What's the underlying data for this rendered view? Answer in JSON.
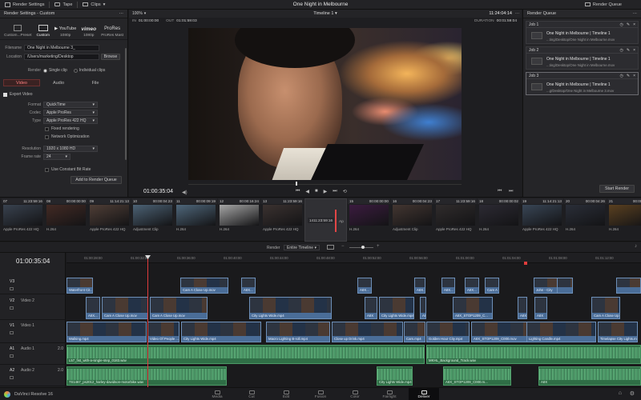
{
  "topbar": {
    "render_settings": "Render Settings",
    "tape": "Tape",
    "clips": "Clips",
    "project_title": "One Night in Melbourne",
    "render_queue": "Render Queue"
  },
  "render_settings": {
    "header": "Render Settings - Custom",
    "presets": [
      "Custom...Preset",
      "Custom",
      "1080p",
      "1080p",
      "ProRes Mast"
    ],
    "filename_label": "Filename",
    "filename_value": "One Night in Melbourne 3_",
    "location_label": "Location",
    "location_value": "/Users/marketing/Desktop",
    "browse": "Browse",
    "render_label": "Render",
    "single_clip": "Single clip",
    "individual_clips": "Individual clips",
    "tab_video": "Video",
    "tab_audio": "Audio",
    "tab_file": "File",
    "export_video": "Export Video",
    "format_label": "Format",
    "format_value": "QuickTime",
    "codec_label": "Codec",
    "codec_value": "Apple ProRes",
    "type_label": "Type",
    "type_value": "Apple ProRes 422 HQ",
    "fixed_rendering": "Fixed rendering",
    "network_opt": "Network Optimization",
    "resolution_label": "Resolution",
    "resolution_value": "1920 x 1080 HD",
    "framerate_label": "Frame rate",
    "framerate_value": "24",
    "constant_bitrate": "Use Constant Bit Rate",
    "add_to_queue": "Add to Render Queue"
  },
  "viewer": {
    "zoom": "100%",
    "in_label": "IN",
    "in_tc": "01:00:00:00",
    "out_label": "OUT",
    "out_tc": "01:01:59:03",
    "timeline_name": "Timeline 1",
    "tc_right": "11:24:04:14",
    "duration_label": "DURATION",
    "duration_tc": "00:01:59:04",
    "current_tc": "01:00:35:04"
  },
  "queue": {
    "header": "Render Queue",
    "jobs": [
      {
        "label": "Job 1",
        "title": "One Night in Melbourne | Timeline 1",
        "path": "...ting/Desktop/One Night in Melbourne.mov"
      },
      {
        "label": "Job 2",
        "title": "One Night in Melbourne | Timeline 1",
        "path": "...ting/Desktop/One Night in Melbourne.mov"
      },
      {
        "label": "Job 3",
        "title": "One Night in Melbourne | Timeline 1",
        "path": "...g/Desktop/One Night in Melbourne 3.mov"
      }
    ],
    "start_render": "Start Render"
  },
  "clipstrip": [
    {
      "num": "07",
      "tc": "11:23:59:16",
      "codec": "Apple ProRes 422 HQ",
      "thumb": "#39424f"
    },
    {
      "num": "08",
      "tc": "00:00:00:00",
      "codec": "H.264",
      "thumb": "#432a24"
    },
    {
      "num": "09",
      "tc": "11:14:21:13",
      "codec": "Apple ProRes 422 HQ",
      "thumb": "#4f3e36"
    },
    {
      "num": "10",
      "tc": "00:00:04:23",
      "codec": "Adjustment Clip",
      "thumb": "#4c6275"
    },
    {
      "num": "11",
      "tc": "00:00:09:19",
      "codec": "H.264",
      "thumb": "#4f677b"
    },
    {
      "num": "12",
      "tc": "00:00:16:24",
      "codec": "H.264",
      "thumb": "#a6a6a6"
    },
    {
      "num": "13",
      "tc": "11:23:59:16",
      "codec": "Apple ProRes 422 HQ",
      "thumb": "#3b3230"
    },
    {
      "num": "14",
      "tc": "11:23:59:16",
      "codec": "Apple ProRes 422 HQ",
      "thumb": "#5a4338"
    },
    {
      "num": "15",
      "tc": "00:00:00:00",
      "codec": "H.264",
      "thumb": "#3b1b3f"
    },
    {
      "num": "16",
      "tc": "00:00:04:23",
      "codec": "Adjustment Clip",
      "thumb": "#433631"
    },
    {
      "num": "17",
      "tc": "11:23:59:16",
      "codec": "Apple ProRes 422 HQ",
      "thumb": "#302c2c"
    },
    {
      "num": "18",
      "tc": "00:00:00:02",
      "codec": "H.264",
      "thumb": "#2c2a33"
    },
    {
      "num": "19",
      "tc": "11:14:21:13",
      "codec": "Apple ProRes 422 HQ",
      "thumb": "#394656"
    },
    {
      "num": "20",
      "tc": "00:00:04:26",
      "codec": "H.264",
      "thumb": "#2a2e38"
    },
    {
      "num": "21",
      "tc": "00:00:09:",
      "codec": "H.264",
      "thumb": "#5a4020"
    }
  ],
  "timeline": {
    "tc": "01:00:35:04",
    "render_label": "Render",
    "render_value": "Entire Timeline",
    "ruler": [
      "01:00:28:00",
      "01:00:32:00",
      "01:00:36:00",
      "01:00:40:00",
      "01:00:44:00",
      "01:00:48:00",
      "01:00:52:00",
      "01:00:56:00",
      "01:01:00:00",
      "01:01:04:00",
      "01:01:08:00",
      "01:01:12:00"
    ],
    "tracks": {
      "v3": "",
      "v2": "Video 2",
      "v1": "Video 1",
      "a1": "Audio 1",
      "a2": "Audio 2",
      "a3": "Audio 3",
      "a1_level": "2.0",
      "a2_level": "2.0",
      "a3_level": "2.0",
      "clips_label": "0 Clips"
    },
    "v3_clips": [
      "Waterfront Cit...",
      "Cam A Close Up.mov",
      "AIIX...",
      "AIIX...",
      "AIIX...",
      "AIIX...",
      "AIIX...",
      "Cam A Close Up",
      "John - City"
    ],
    "v2_clips": [
      "AIIX...",
      "Cam A Close Up.mov",
      "Cam A Close Up.mov",
      "City Lights Wide.mp4",
      "AIIX",
      "City Lights Wide.mp4",
      "AIIX...",
      "AIIX_STOP1209_C...",
      "AIIX",
      "AIIX",
      "Cam A Close Up"
    ],
    "v1_clips": [
      "Walking.mp4",
      "Video Of People ...",
      "City Lights Wide.mp4",
      "Macro Lighting B-roll.mp4",
      "Close up Drink.mp4",
      "Cars.mp4",
      "Golden Hour City.mp4",
      "AIIX_STOP1209_C000.mov",
      "Lighting Candle.mp4",
      "Timelapse City Lights.mp4"
    ],
    "a1_clips": [
      "L57_fist_with-a-single-step_0183.wav",
      "MKHL_Background_Track.wav"
    ],
    "a2_clips": [
      "7S1467_ps2012_harley-davidson-motorbike.wav",
      "City Lights Wide.mp4",
      "AIIX_STOP1209_C000.m...",
      "AIIX"
    ]
  },
  "pages": [
    "Media",
    "Cut",
    "Edit",
    "Fusion",
    "Color",
    "Fairlight",
    "Deliver"
  ],
  "app_name": "DaVinci Resolve 16"
}
